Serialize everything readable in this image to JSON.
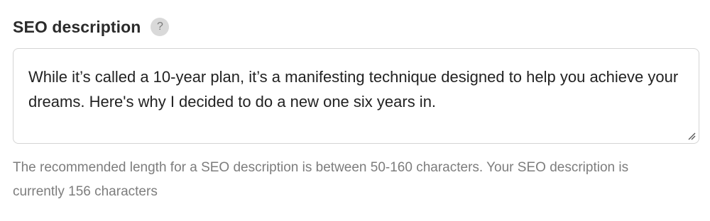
{
  "field": {
    "label": "SEO description",
    "help_icon_glyph": "?",
    "help_icon_name": "question-mark-icon",
    "value": "While it’s called a 10-year plan, it’s a manifesting technique designed to help you achieve your dreams. Here's why I decided to do a new one six years in.",
    "hint": "The recommended length for a SEO description is between 50-160 characters. Your SEO description is currently 156 characters"
  }
}
